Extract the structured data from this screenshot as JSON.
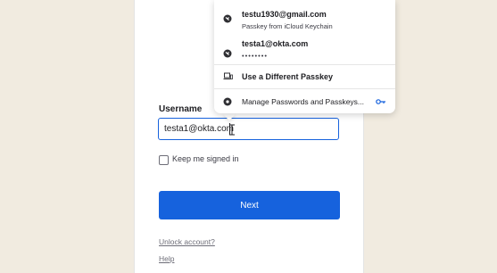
{
  "login": {
    "username_label": "Username",
    "username_value": "testa1@okta.com",
    "keep_signed_in_label": "Keep me signed in",
    "next_label": "Next",
    "unlock_link": "Unlock account?",
    "help_link": "Help"
  },
  "passkey_popup": {
    "items": [
      {
        "title": "testu1930@gmail.com",
        "subtitle": "Passkey from iCloud Keychain",
        "icon": "passkey-globe-icon"
      },
      {
        "title": "testa1@okta.com",
        "subtitle": "••••••••",
        "icon": "passkey-globe-icon"
      },
      {
        "title": "Use a Different Passkey",
        "icon": "device-icon"
      },
      {
        "title": "Manage Passwords and Passkeys...",
        "icon": "key-manager-icon"
      }
    ]
  },
  "colors": {
    "primary": "#1662dd",
    "background": "#f1ebe0"
  }
}
